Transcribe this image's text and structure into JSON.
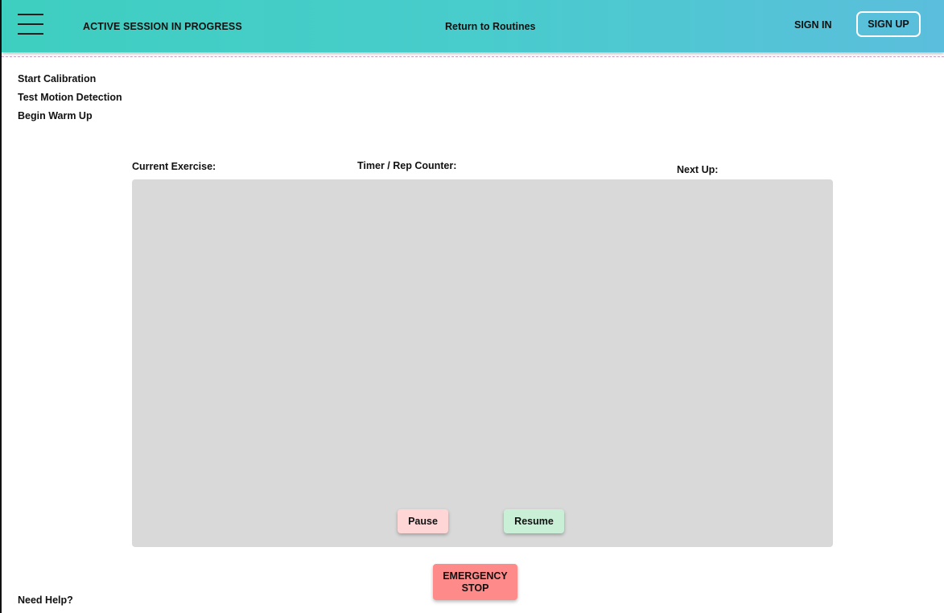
{
  "header": {
    "session_title": "ACTIVE SESSION IN PROGRESS",
    "return_link": "Return to Routines",
    "sign_in": "SIGN IN",
    "sign_up": "SIGN UP"
  },
  "side_menu": {
    "items": [
      {
        "label": "Start Calibration"
      },
      {
        "label": "Test Motion Detection"
      },
      {
        "label": "Begin Warm Up"
      }
    ]
  },
  "main": {
    "current_exercise_label": "Current Exercise:",
    "timer_label": "Timer / Rep Counter:",
    "next_up_label": "Next Up:",
    "pause_label": "Pause",
    "resume_label": "Resume",
    "emergency_label": "EMERGENCY STOP"
  },
  "footer": {
    "help_label": "Need Help?"
  },
  "colors": {
    "header_gradient_start": "#3ecfc0",
    "header_gradient_end": "#5bbedc",
    "video_placeholder": "#d9d9d9",
    "pause_button": "#ffd6d6",
    "resume_button": "#c9f0d6",
    "emergency_button": "#ff8a8a"
  },
  "icons": {
    "menu": "hamburger-menu-icon"
  }
}
